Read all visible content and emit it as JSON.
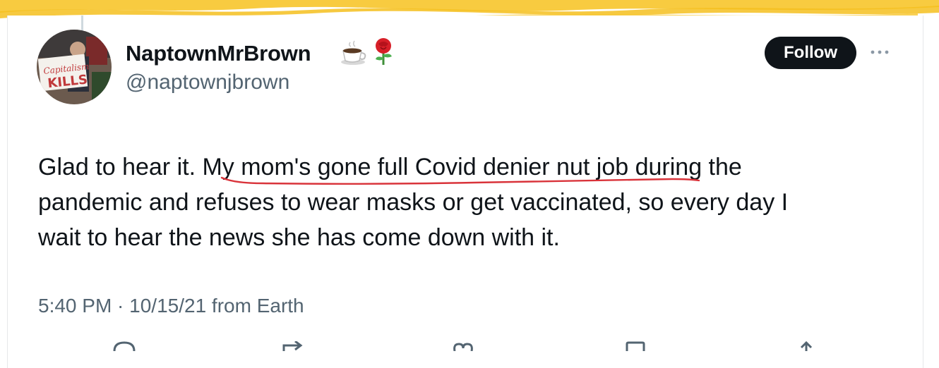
{
  "tweet": {
    "display_name": "NaptownMrBrown",
    "name_emojis": [
      "coffee-icon",
      "rose-icon"
    ],
    "handle": "@naptownjbrown",
    "follow_label": "Follow",
    "text_lines": {
      "line1_pre": "Glad to hear it. ",
      "line1_highlight": "My mom's gone full Covid denier nut job",
      "line1_post": " during the",
      "line2": "pandemic and refuses to wear masks or get vaccinated, so every day I",
      "line3": "wait to hear the news she has come down with it."
    },
    "timestamp": "5:40 PM · 10/15/21 from Earth"
  },
  "colors": {
    "highlighter": "#f7c52b",
    "underline": "#d9333a",
    "secondary_text": "#536471",
    "follow_bg": "#0f1419"
  },
  "actions": [
    "reply-icon",
    "retweet-icon",
    "like-icon",
    "bookmark-icon",
    "share-icon"
  ]
}
